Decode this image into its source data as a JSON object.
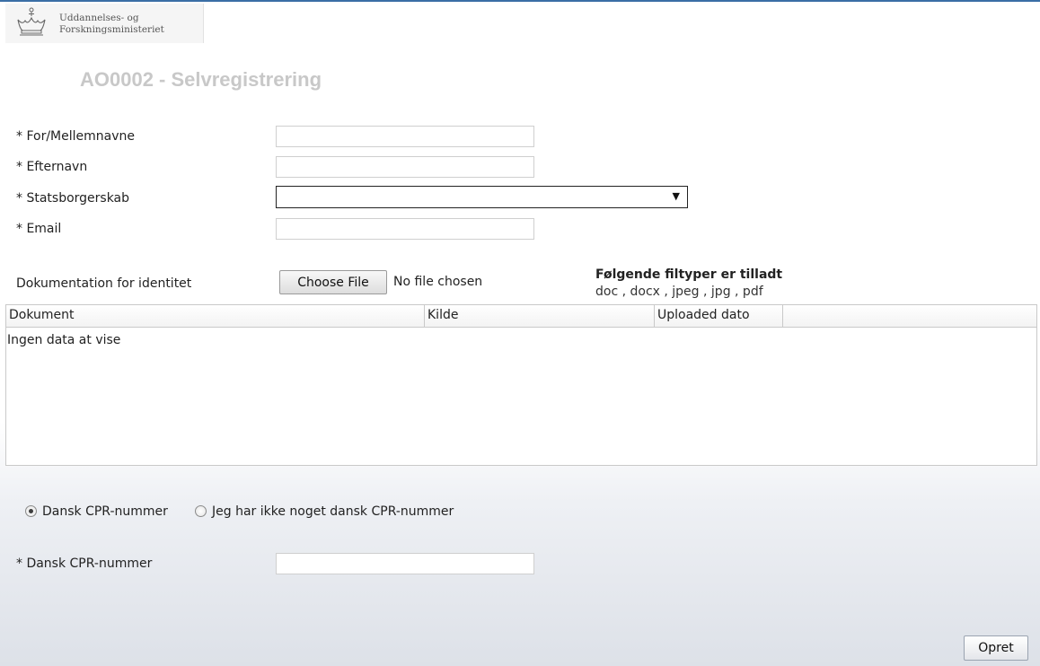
{
  "header": {
    "logo_line1": "Uddannelses- og",
    "logo_line2": "Forskningsministeriet"
  },
  "page_title": "AO0002 - Selvregistrering",
  "form": {
    "first_name_label": "* For/Mellemnavne",
    "first_name_value": "",
    "last_name_label": "* Efternavn",
    "last_name_value": "",
    "citizenship_label": "* Statsborgerskab",
    "citizenship_value": "",
    "email_label": "* Email",
    "email_value": ""
  },
  "upload": {
    "label": "Dokumentation for identitet",
    "choose_file_label": "Choose File",
    "no_file_text": "No file chosen",
    "allowed_types_title": "Følgende filtyper er tilladt",
    "allowed_types": "doc , docx , jpeg , jpg , pdf"
  },
  "table": {
    "columns": [
      "Dokument",
      "Kilde",
      "Uploaded dato"
    ],
    "empty_text": "Ingen data at vise"
  },
  "cpr": {
    "option_danish": "Dansk CPR-nummer",
    "option_none": "Jeg har ikke noget dansk CPR-nummer",
    "selected": "Dansk CPR-nummer",
    "field_label": "* Dansk CPR-nummer",
    "field_value": ""
  },
  "submit_label": "Opret"
}
